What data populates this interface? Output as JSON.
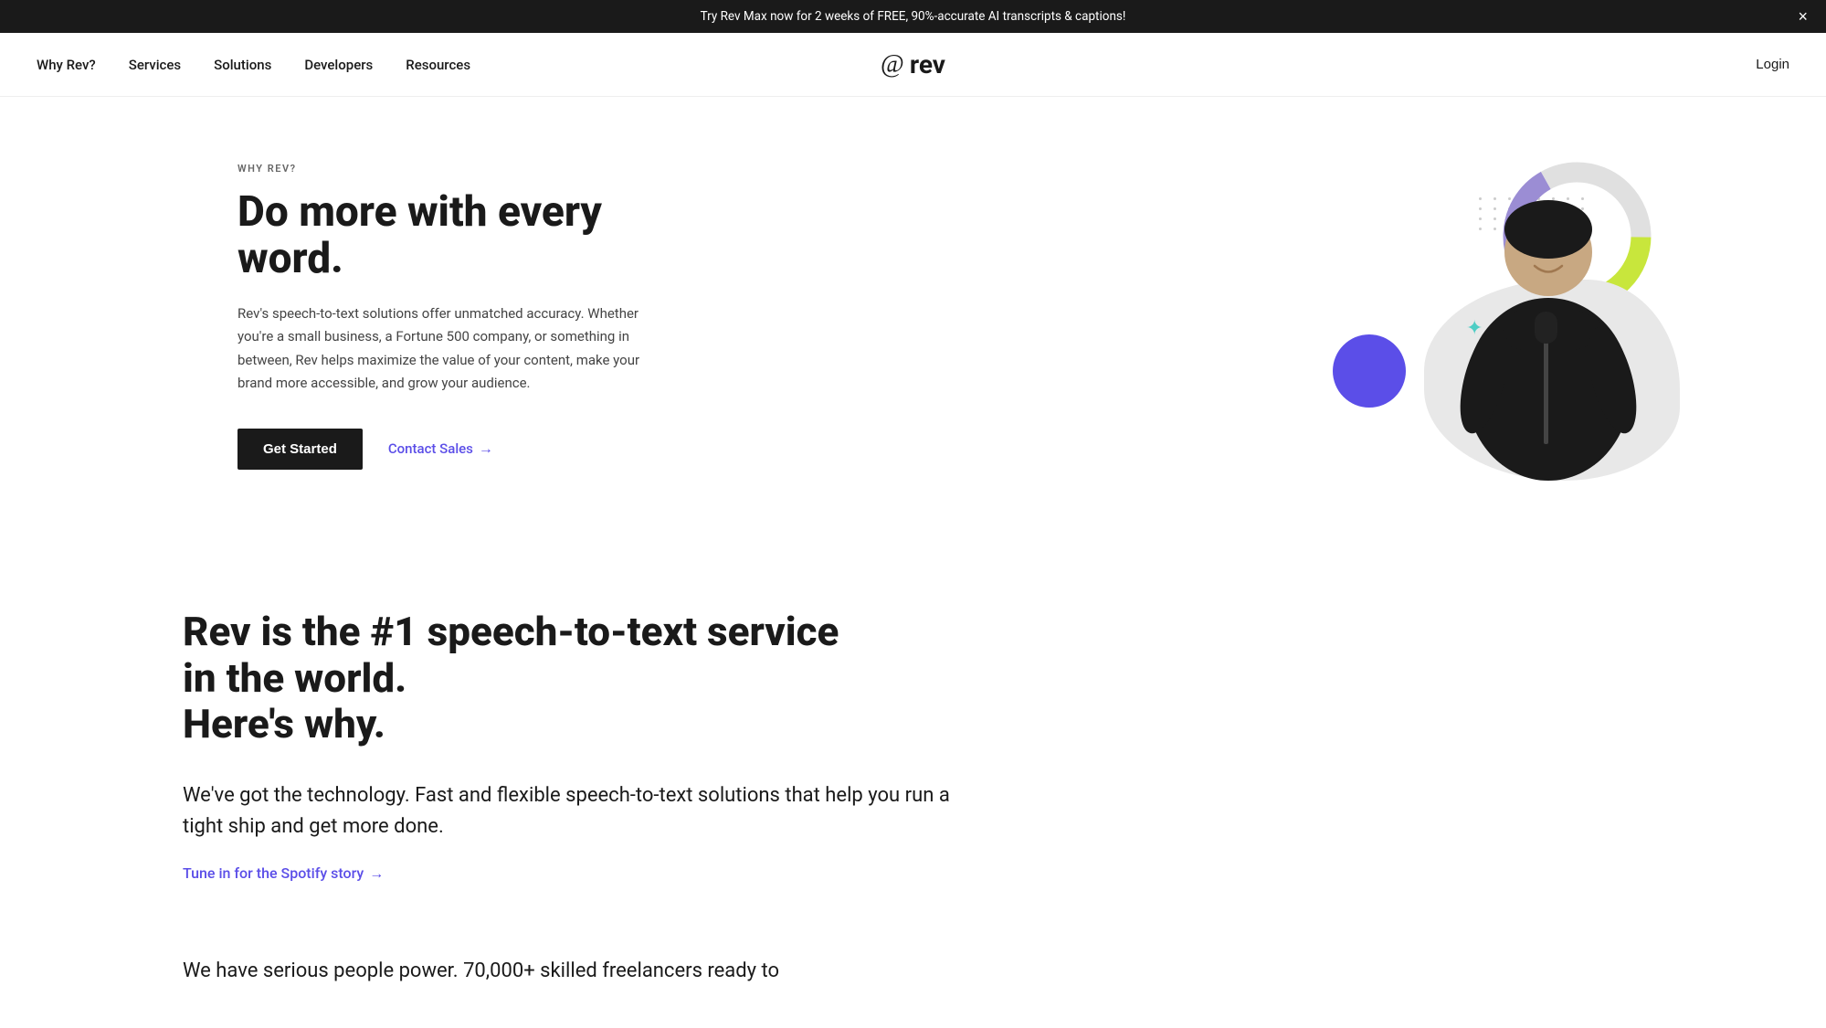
{
  "announcement": {
    "text": "Try Rev Max now for 2 weeks of FREE, 90%-accurate AI transcripts & captions!",
    "close_label": "×"
  },
  "nav": {
    "why_rev": "Why Rev?",
    "services": "Services",
    "solutions": "Solutions",
    "developers": "Developers",
    "resources": "Resources",
    "logo_at": "@",
    "logo_text": "rev",
    "login": "Login"
  },
  "hero": {
    "eyebrow": "WHY REV?",
    "title": "Do more with every word.",
    "description": "Rev's speech-to-text solutions offer unmatched accuracy. Whether you're a small business, a Fortune 500 company, or something in between, Rev helps maximize the value of your content, make your brand more accessible, and grow your audience.",
    "cta_primary": "Get Started",
    "cta_secondary": "Contact Sales",
    "cta_secondary_arrow": "→"
  },
  "section_why": {
    "heading_line1": "Rev is the #1 speech-to-text service in the world.",
    "heading_line2": "Here's why.",
    "body": "We've got the technology. Fast and flexible speech-to-text solutions that help you run a tight ship and get more done.",
    "link_label": "Tune in for the Spotify story",
    "link_arrow": "→"
  },
  "section_partial": {
    "text_partial": "We have serious people power. 70,000+ skilled freelancers ready to"
  },
  "colors": {
    "accent_purple": "#5b4ee8",
    "accent_green": "#c8e63c",
    "dark": "#1a1a1a",
    "blob": "#e8e8e8",
    "circle_purple": "#9b8dd4"
  }
}
